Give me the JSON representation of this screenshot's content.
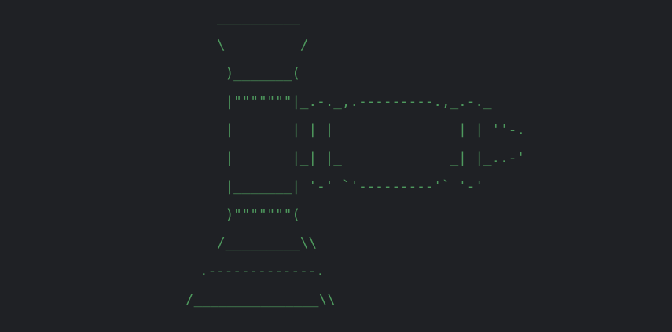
{
  "theme": {
    "background": "#1f2125",
    "text_color": "#4e9a5e"
  },
  "ascii_art": {
    "lines": [
      "__________",
      "\\         /",
      " )_______(",
      " |\"\"\"\"\"\"\"|_.-._,.---------.,_.-._",
      " |       | | |               | | ''-.",
      " |       |_| |_             _| |_..-'",
      " |_______| '-' `'---------'` '-'",
      " )\"\"\"\"\"\"\"(",
      "/_________\\\\",
      ".-------------.",
      "/_______________\\\\"
    ]
  }
}
